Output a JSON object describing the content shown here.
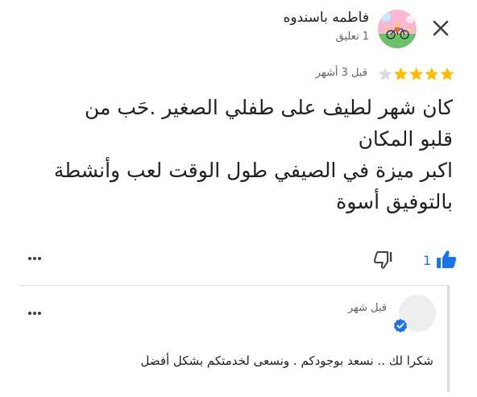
{
  "header": {
    "author_name": "فاطمه باسندوه",
    "author_meta": "1 تعليق",
    "close_icon": "close-icon"
  },
  "review": {
    "rating": 4,
    "max_rating": 5,
    "time": "قبل 3 أشهر",
    "text": "كان شهر لطيف على طفلي الصغير .حَب من\nقلبو المكان\nاكبر ميزة في الصيفي طول الوقت لعب وأنشطة\nبالتوفيق أسوة",
    "like_count": "1",
    "colors": {
      "star": "#fbbc04",
      "star_empty": "#dadce0",
      "accent": "#1a73e8"
    }
  },
  "reply": {
    "time": "قبل شهر",
    "text": "شكرا لك .. نسعد بوجودكم . ونسعى لخدمتكم بشكل أفضل"
  }
}
